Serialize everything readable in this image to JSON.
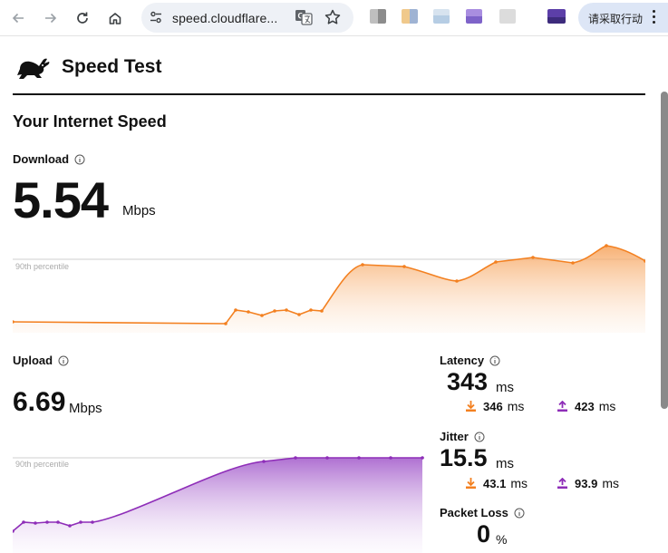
{
  "browser": {
    "url": "speed.cloudflare...",
    "action_label": "请采取行动",
    "accent": "#dde6f6"
  },
  "page": {
    "brand": "Speed Test",
    "section_title": "Your Internet Speed",
    "download": {
      "label": "Download",
      "value": "5.54",
      "unit": "Mbps",
      "percentile_label": "90th percentile",
      "color": "#f38020",
      "trend": [
        {
          "y": 1.8
        },
        {
          "y": 1.8
        },
        {
          "y": 3.6
        },
        {
          "y": 3.4
        },
        {
          "y": 3.2
        },
        {
          "y": 3.4
        },
        {
          "y": 3.5
        },
        {
          "y": 3.2
        },
        {
          "y": 3.5
        },
        {
          "y": 3.5
        },
        {
          "y": 5.9
        },
        {
          "y": 5.9
        },
        {
          "y": 5.6
        },
        {
          "y": 5.9
        },
        {
          "y": 6.0
        },
        {
          "y": 6.1
        },
        {
          "y": 5.9
        },
        {
          "y": 6.3
        },
        {
          "y": 6.1
        }
      ]
    },
    "upload": {
      "label": "Upload",
      "value": "6.69",
      "unit": "Mbps",
      "percentile_label": "90th percentile",
      "color": "#8e2db8"
    },
    "latency": {
      "label": "Latency",
      "value": "343",
      "unit": "ms",
      "down": "346",
      "up": "423",
      "sub_unit": "ms"
    },
    "jitter": {
      "label": "Jitter",
      "value": "15.5",
      "unit": "ms",
      "down": "43.1",
      "up": "93.9",
      "sub_unit": "ms"
    },
    "packet_loss": {
      "label": "Packet Loss",
      "value": "0",
      "unit": "%"
    }
  }
}
